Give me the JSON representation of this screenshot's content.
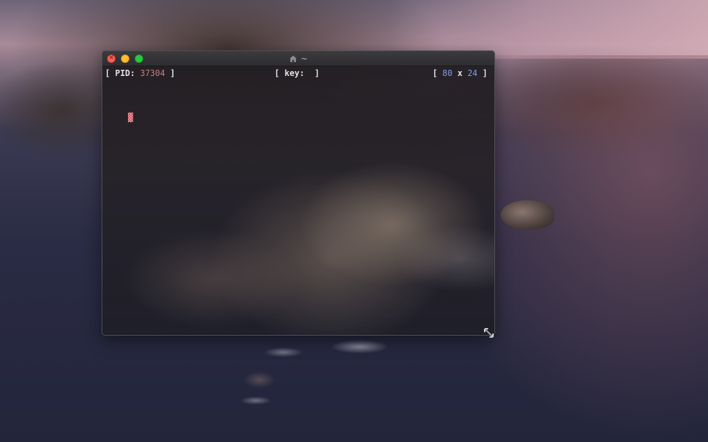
{
  "window": {
    "title": "~",
    "title_icon": "home-icon",
    "traffic_lights": {
      "close_glyph": "×",
      "colors": {
        "close": "#fe5f57",
        "minimize": "#febc2e",
        "zoom": "#28c840"
      }
    }
  },
  "status_bar": {
    "pid_label": "PID:",
    "pid_value": "37304",
    "key_label": "key:",
    "key_value": "",
    "cols": "80",
    "x_sep": "x",
    "rows": "24",
    "bracket_open": "[",
    "bracket_close": "]"
  },
  "terminal": {
    "cursor_glyph": "▓"
  },
  "colors": {
    "pid_value": "#c27f86",
    "dimension_value": "#7f9ee8",
    "cursor": "#ff8b95"
  },
  "icons": {
    "resize": "resize-diagonal-icon"
  }
}
